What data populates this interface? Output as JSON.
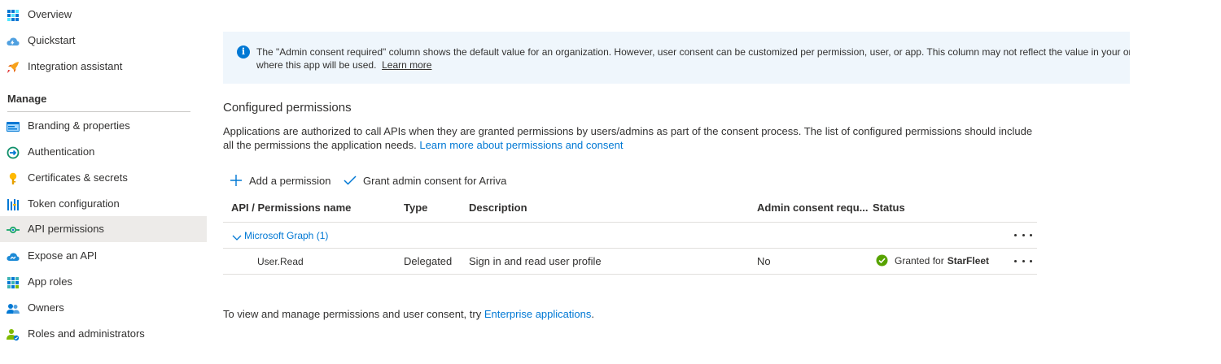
{
  "sidebar": {
    "items_top": [
      {
        "label": "Overview",
        "icon": "grid-icon"
      },
      {
        "label": "Quickstart",
        "icon": "cloud-lightning-icon"
      },
      {
        "label": "Integration assistant",
        "icon": "rocket-icon"
      }
    ],
    "section_header": "Manage",
    "items_manage": [
      {
        "label": "Branding & properties",
        "icon": "branding-icon"
      },
      {
        "label": "Authentication",
        "icon": "authentication-icon"
      },
      {
        "label": "Certificates & secrets",
        "icon": "key-icon"
      },
      {
        "label": "Token configuration",
        "icon": "token-bars-icon"
      },
      {
        "label": "API permissions",
        "icon": "api-permissions-icon",
        "active": true
      },
      {
        "label": "Expose an API",
        "icon": "cloud-api-icon"
      },
      {
        "label": "App roles",
        "icon": "app-roles-grid-icon"
      },
      {
        "label": "Owners",
        "icon": "users-icon"
      },
      {
        "label": "Roles and administrators",
        "icon": "user-admin-icon"
      }
    ]
  },
  "banner": {
    "text": "The \"Admin consent required\" column shows the default value for an organization. However, user consent can be customized per permission, user, or app. This column may not reflect the value in your organization, or in organizations where this app will be used.",
    "link": "Learn more"
  },
  "main": {
    "title": "Configured permissions",
    "description": "Applications are authorized to call APIs when they are granted permissions by users/admins as part of the consent process. The list of configured permissions should include all the permissions the application needs.",
    "description_link": "Learn more about permissions and consent",
    "add_permission": "Add a permission",
    "grant_consent": "Grant admin consent for Arriva"
  },
  "table": {
    "headers": [
      "API / Permissions name",
      "Type",
      "Description",
      "Admin consent requ...",
      "Status"
    ],
    "group": "Microsoft Graph (1)",
    "rows": [
      {
        "name": "User.Read",
        "type": "Delegated",
        "description": "Sign in and read user profile",
        "admin_consent": "No",
        "status_prefix": "Granted for",
        "status_tenant": "StarFleet"
      }
    ]
  },
  "footer": {
    "text": "To view and manage permissions and user consent, try",
    "link": "Enterprise applications",
    "suffix": "."
  },
  "colors": {
    "accent": "#0078d4",
    "banner_bg": "#eff6fc",
    "active_nav_bg": "#edebe9",
    "success": "#57a300"
  }
}
